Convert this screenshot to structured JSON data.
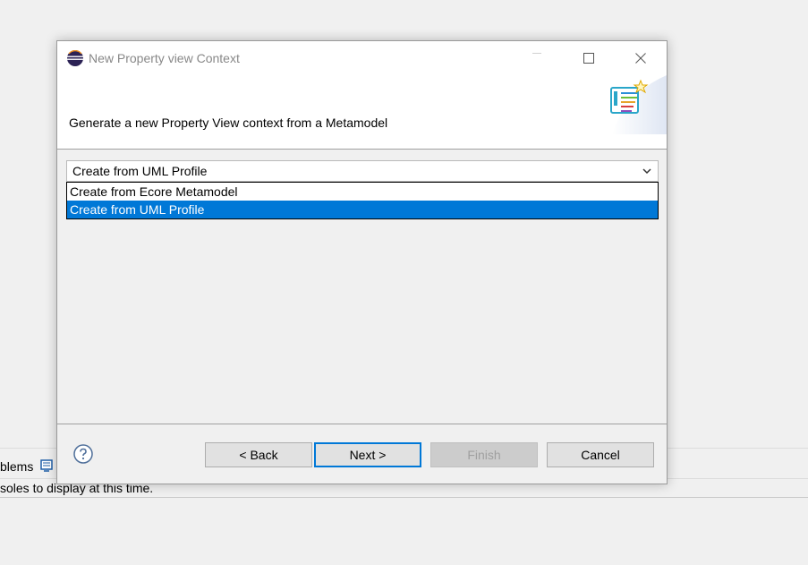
{
  "background": {
    "tab_label": "blems",
    "console_message": "soles to display at this time."
  },
  "dialog": {
    "title": "New Property view Context",
    "description": "Generate a new Property View context from a Metamodel",
    "combo": {
      "selected": "Create from UML Profile",
      "options": [
        "Create from Ecore Metamodel",
        "Create from UML Profile"
      ],
      "highlighted_index": 1
    },
    "buttons": {
      "back": "< Back",
      "next": "Next >",
      "finish": "Finish",
      "cancel": "Cancel"
    }
  },
  "colors": {
    "selection": "#0078d7",
    "default_button_border": "#0078d7",
    "disabled_text": "#a0a0a0"
  },
  "icons": {
    "app": "eclipse-icon",
    "banner": "property-view-wizard-icon",
    "help": "help-icon",
    "dropdown": "chevron-down-icon"
  }
}
